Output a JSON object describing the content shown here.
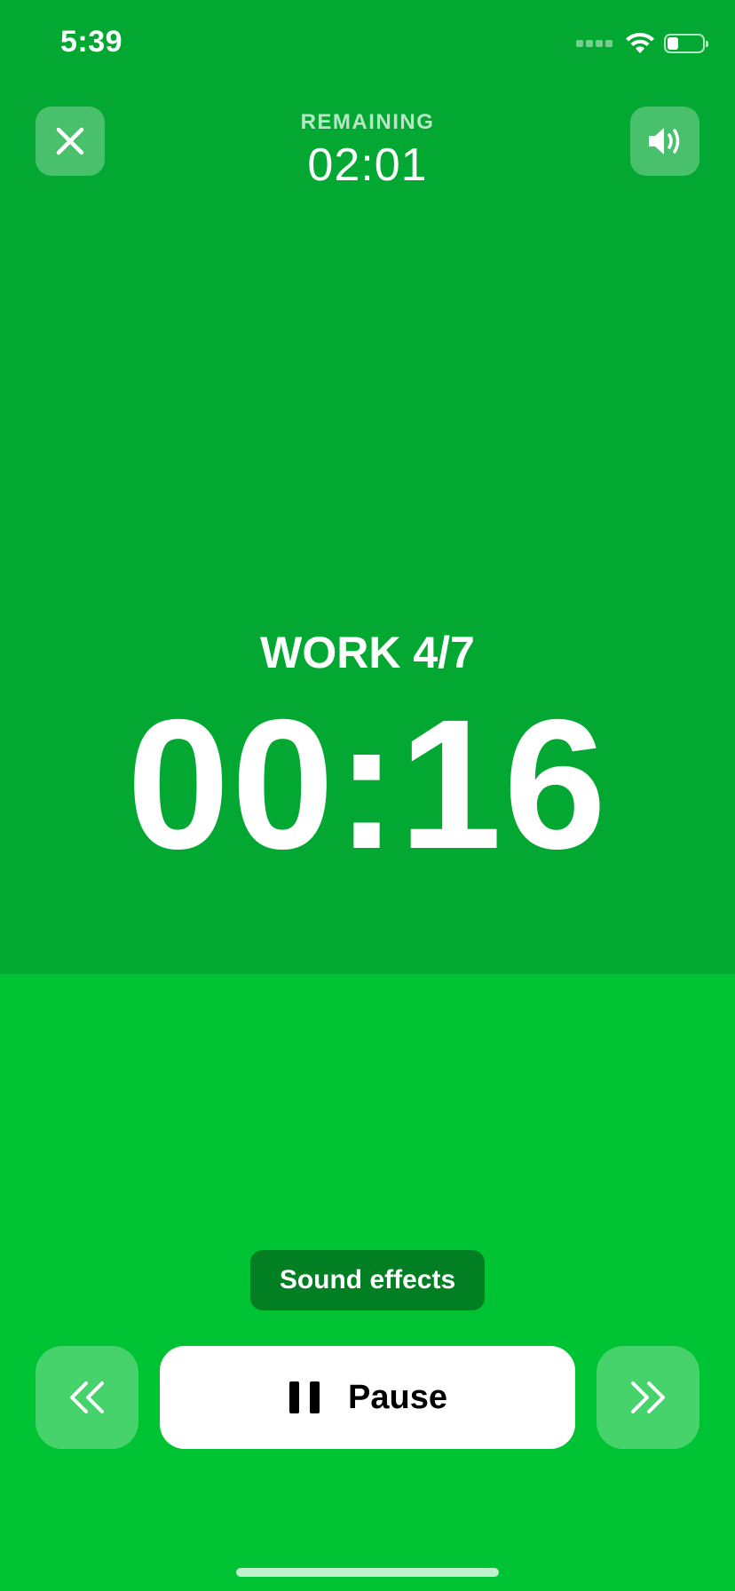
{
  "status_bar": {
    "time": "5:39"
  },
  "header": {
    "close_icon": "close-icon",
    "sound_icon": "speaker-icon",
    "remaining_label": "REMAINING",
    "remaining_value": "02:01"
  },
  "main": {
    "phase_label": "WORK 4/7",
    "phase_timer": "00:16"
  },
  "controls": {
    "sound_effects_label": "Sound effects",
    "previous_icon": "chevrons-left-icon",
    "pause_icon": "pause-icon",
    "pause_label": "Pause",
    "next_icon": "chevrons-right-icon"
  },
  "colors": {
    "top_background": "#03a832",
    "bottom_background": "#00c333",
    "pill_background": "#027f22"
  }
}
